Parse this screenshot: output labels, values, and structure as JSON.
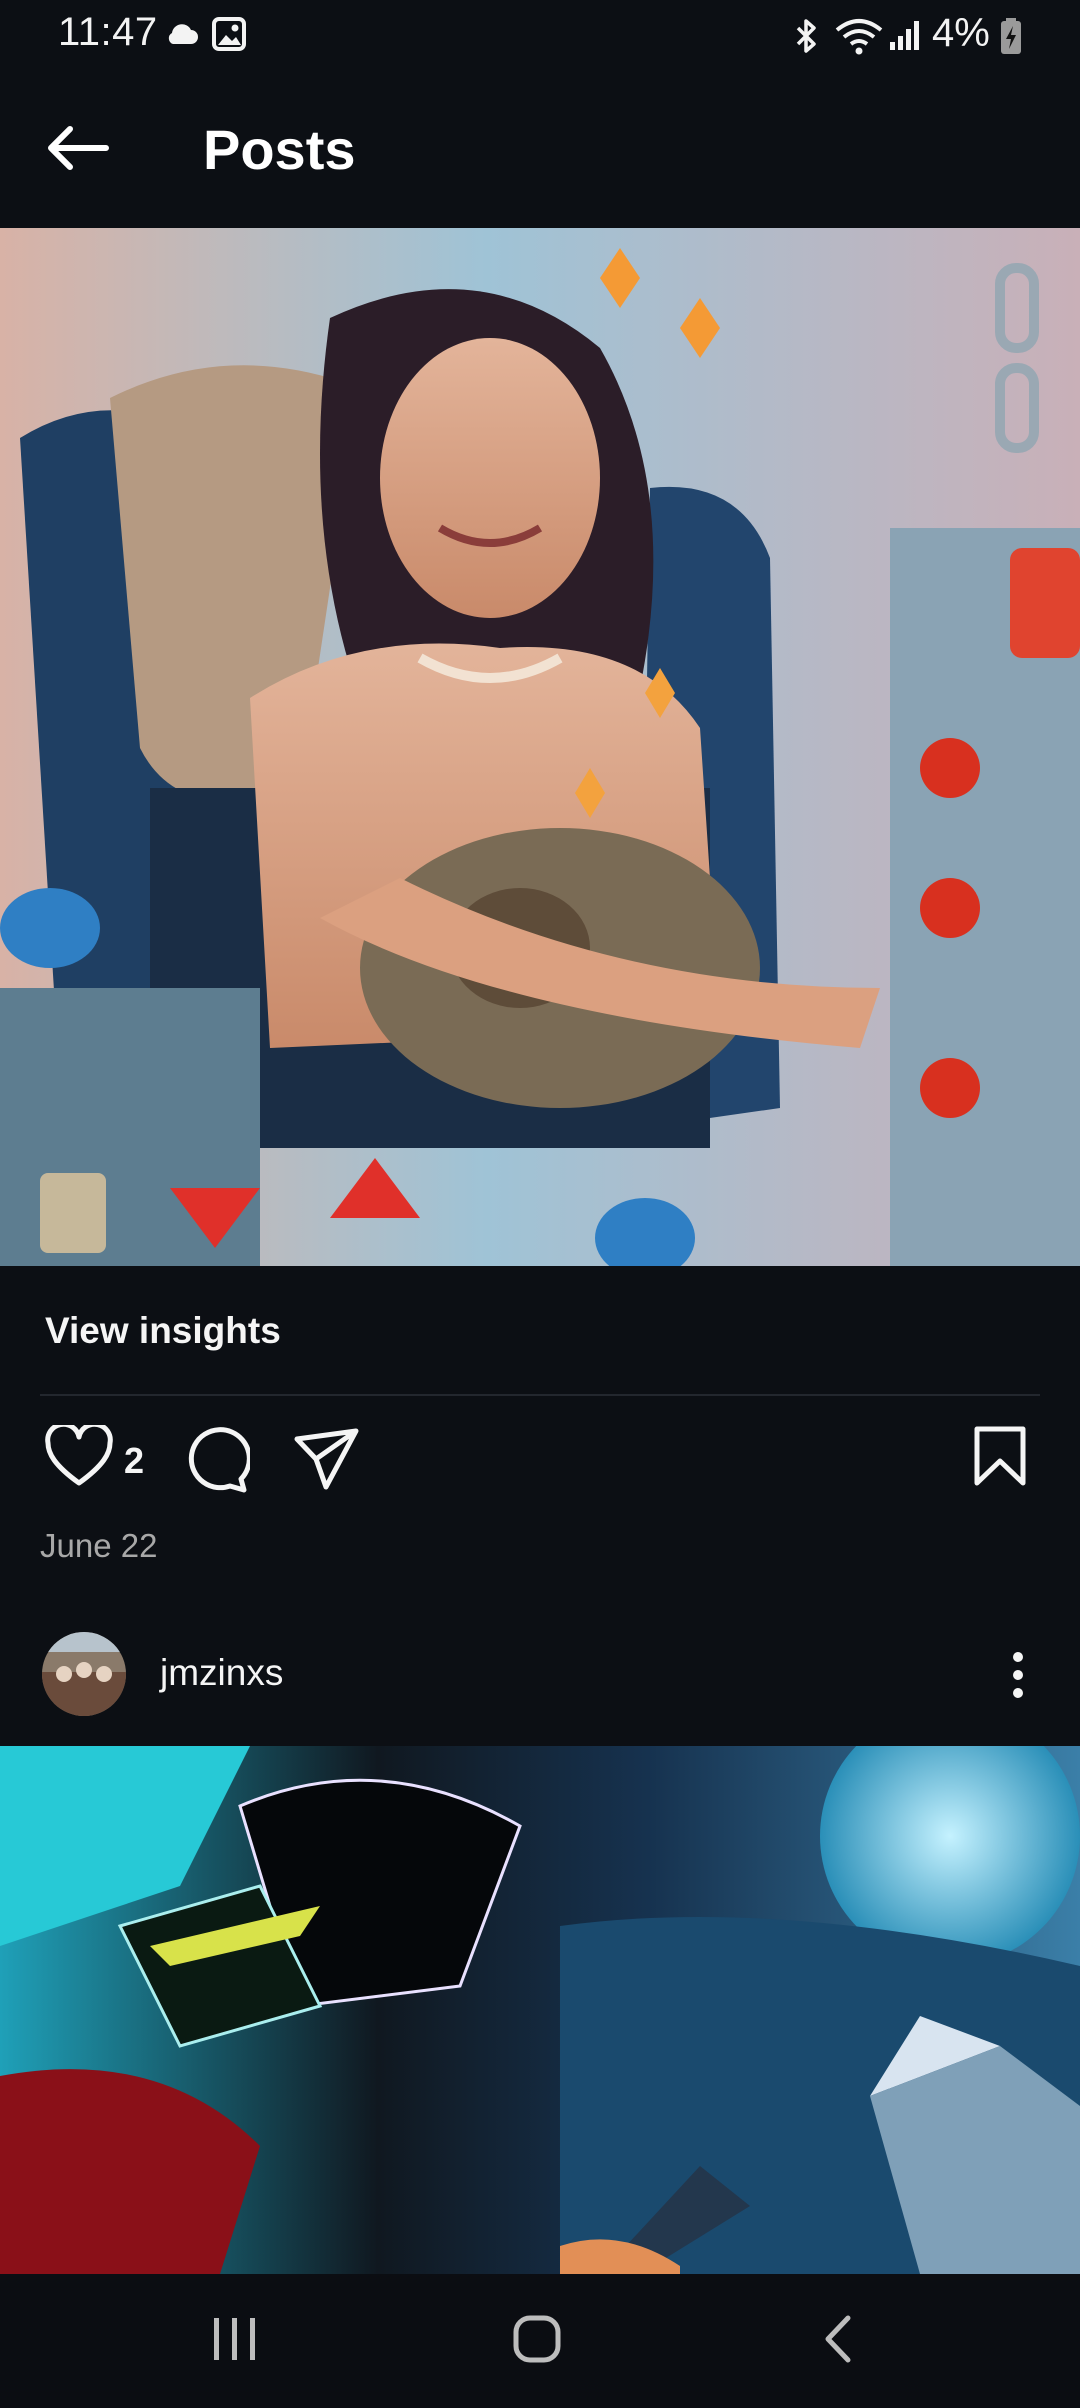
{
  "status_bar": {
    "time": "11:47",
    "battery": "4%",
    "icons": [
      "cloud-icon",
      "image-icon",
      "bluetooth-icon",
      "wifi-icon",
      "signal-icon",
      "battery-charging-icon"
    ]
  },
  "header": {
    "title": "Posts",
    "back_icon": "arrow-left-icon"
  },
  "post": {
    "insights_label": "View insights",
    "like_count": "2",
    "date": "June 22",
    "action_icons": [
      "heart-icon",
      "comment-icon",
      "share-icon",
      "bookmark-icon"
    ]
  },
  "next_post": {
    "username": "jmzinxs",
    "more_icon": "more-vertical-icon"
  },
  "nav": {
    "icons": [
      "recents-icon",
      "home-icon",
      "back-icon"
    ]
  },
  "colors": {
    "background": "#0c0f14",
    "text": "#f5f5f5",
    "muted": "#a8a8a8"
  }
}
